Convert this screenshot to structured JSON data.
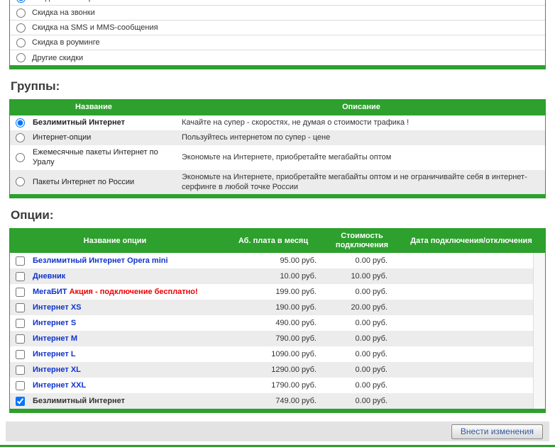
{
  "colors": {
    "green": "#2da02d",
    "link_blue": "#0f33cc",
    "promo_red": "#ee0000",
    "row_alt": "#ececec"
  },
  "discounts": {
    "items": [
      {
        "label": "Скидка на Интернет",
        "checked": true
      },
      {
        "label": "Скидка на звонки",
        "checked": false
      },
      {
        "label": "Скидка на SMS и MMS-сообщения",
        "checked": false
      },
      {
        "label": "Скидка в роуминге",
        "checked": false
      },
      {
        "label": "Другие скидки",
        "checked": false
      }
    ]
  },
  "groups": {
    "title": "Группы:",
    "columns": {
      "name": "Название",
      "desc": "Описание"
    },
    "rows": [
      {
        "name": "Безлимитный Интернет",
        "bold": true,
        "selected": true,
        "description": "Качайте на супер - скоростях, не думая о стоимости трафика !"
      },
      {
        "name": "Интернет-опции",
        "bold": false,
        "selected": false,
        "description": "Пользуйтесь интернетом по супер - цене"
      },
      {
        "name": "Ежемесячные пакеты Интернет по Уралу",
        "bold": false,
        "selected": false,
        "description": "Экономьте на Интернете, приобретайте мегабайты оптом"
      },
      {
        "name": "Пакеты Интернет по России",
        "bold": false,
        "selected": false,
        "description": "Экономьте на Интернете, приобретайте мегабайты оптом и не ограничивайте себя в интернет-серфинге в любой точке России"
      }
    ]
  },
  "options": {
    "title": "Опции:",
    "columns": {
      "name": "Название опции",
      "fee": "Аб. плата в месяц",
      "connect": "Стоимость подключения",
      "date": "Дата подключения/отключения"
    },
    "rows": [
      {
        "name": "Безлимитный Интернет Opera mini",
        "fee": "95.00 руб.",
        "connect": "0.00 руб.",
        "date": "",
        "checked": false,
        "plain": false
      },
      {
        "name": "Дневник",
        "fee": "10.00 руб.",
        "connect": "10.00 руб.",
        "date": "",
        "checked": false,
        "plain": false
      },
      {
        "name": "МегаБИТ",
        "name_red": "Акция - подключение бесплатно!",
        "fee": "199.00 руб.",
        "connect": "0.00 руб.",
        "date": "",
        "checked": false,
        "plain": false
      },
      {
        "name": "Интернет XS",
        "fee": "190.00 руб.",
        "connect": "20.00 руб.",
        "date": "",
        "checked": false,
        "plain": false
      },
      {
        "name": "Интернет S",
        "fee": "490.00 руб.",
        "connect": "0.00 руб.",
        "date": "",
        "checked": false,
        "plain": false
      },
      {
        "name": "Интернет M",
        "fee": "790.00 руб.",
        "connect": "0.00 руб.",
        "date": "",
        "checked": false,
        "plain": false
      },
      {
        "name": "Интернет L",
        "fee": "1090.00 руб.",
        "connect": "0.00 руб.",
        "date": "",
        "checked": false,
        "plain": false
      },
      {
        "name": "Интернет XL",
        "fee": "1290.00 руб.",
        "connect": "0.00 руб.",
        "date": "",
        "checked": false,
        "plain": false
      },
      {
        "name": "Интернет XXL",
        "fee": "1790.00 руб.",
        "connect": "0.00 руб.",
        "date": "",
        "checked": false,
        "plain": false
      },
      {
        "name": "Безлимитный Интернет",
        "fee": "749.00 руб.",
        "connect": "0.00 руб.",
        "date": "",
        "checked": true,
        "plain": true
      }
    ]
  },
  "footer": {
    "submit_label": "Внести изменения"
  }
}
